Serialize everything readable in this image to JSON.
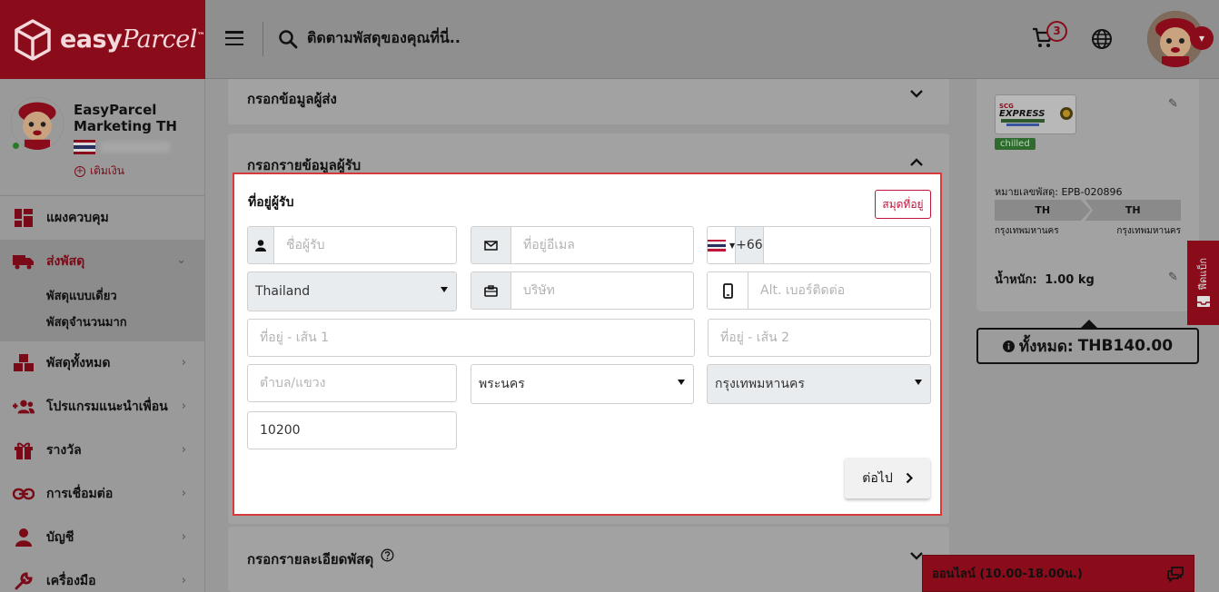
{
  "brand": {
    "name_easy": "easy",
    "name_parcel": "Parcel",
    "tm": "™"
  },
  "header": {
    "search_placeholder": "ติดตามพัสดุของคุณที่นี่..",
    "cart_count": "3"
  },
  "profile": {
    "name": "EasyParcel Marketing TH",
    "topup_label": "เติมเงิน"
  },
  "nav": {
    "dashboard": "แผงควบคุม",
    "send_parcel": "ส่งพัสดุ",
    "single_parcel": "พัสดุแบบเดี่ยว",
    "bulk_parcel": "พัสดุจำนวนมาก",
    "all_parcels": "พัสดุทั้งหมด",
    "referral": "โปรแกรมแนะนำเพื่อน",
    "rewards": "รางวัล",
    "integration": "การเชื่อมต่อ",
    "account": "บัญชี",
    "tools": "เครื่องมือ"
  },
  "sections": {
    "sender": "กรอกข้อมูลผู้ส่ง",
    "receiver": "กรอกรายข้อมูลผู้รับ",
    "parcel": "กรอกรายละเอียดพัสดุ"
  },
  "form": {
    "title": "ที่อยู่ผู้รับ",
    "address_book_label": "สมุดที่อยู่",
    "name_placeholder": "ชื่อผู้รับ",
    "email_placeholder": "ที่อยู่อีเมล",
    "phone_code": "+66",
    "phone_value": "",
    "country": "Thailand",
    "company_placeholder": "บริษัท",
    "alt_phone_placeholder": "Alt. เบอร์ติดต่อ",
    "address1_placeholder": "ที่อยู่ - เส้น 1",
    "address2_placeholder": "ที่อยู่ - เส้น 2",
    "subdistrict_placeholder": "ตำบล/แขวง",
    "district": "พระนคร",
    "province": "กรุงเทพมหานคร",
    "postcode": "10200",
    "next_label": "ต่อไป"
  },
  "summary": {
    "courier_chip": "chilled",
    "tracking_label": "หมายเลขพัสดุ: EPB-020896",
    "from_code": "TH",
    "to_code": "TH",
    "from_city": "กรุงเทพมหานคร",
    "to_city": "กรุงเทพมหานคร",
    "weight_label": "น้ำหนัก:",
    "weight_value": "1.00 kg",
    "total_label": "ทั้งหมด:",
    "total_value": "THB140.00"
  },
  "feedback_label": "ฟีดแบ็ก",
  "chat": {
    "label": "ออนไลน์ (10.00-18.00น.)"
  },
  "colors": {
    "brand_red": "#c0153a",
    "modal_border": "#d63a3a"
  }
}
